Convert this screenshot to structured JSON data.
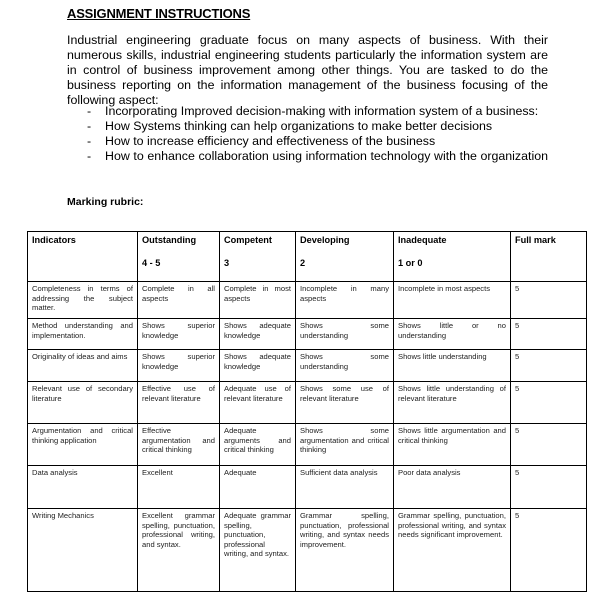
{
  "document": {
    "title": "ASSIGNMENT INSTRUCTIONS",
    "paragraph": "Industrial engineering graduate focus on many aspects of business. With their numerous skills, industrial engineering students particularly the information system are in control of business improvement among other things. You are tasked to do the business reporting on the information management of the business focusing of the following aspect:",
    "bullets": [
      "Incorporating Improved decision-making with information system of a business:",
      "How Systems thinking can help organizations to make better decisions",
      "How to increase efficiency and effectiveness of the business",
      "How to enhance collaboration using information technology with the organization"
    ],
    "bullet_marker": "-",
    "rubric_heading": "Marking rubric:"
  },
  "rubric": {
    "headers": [
      {
        "label": "Indicators",
        "range": ""
      },
      {
        "label": "Outstanding",
        "range": "4 - 5"
      },
      {
        "label": "Competent",
        "range": "3"
      },
      {
        "label": "Developing",
        "range": "2"
      },
      {
        "label": "Inadequate",
        "range": "1 or 0"
      },
      {
        "label": "Full mark",
        "range": ""
      }
    ],
    "rows": [
      {
        "indicator": "Completeness in terms of addressing the subject matter.",
        "outstanding": "Complete in all aspects",
        "competent": "Complete in most aspects",
        "developing": "Incomplete in many aspects",
        "inadequate": "Incomplete in most aspects",
        "full_mark": "5"
      },
      {
        "indicator": "Method understanding and implementation.",
        "outstanding": "Shows superior knowledge",
        "competent": "Shows adequate knowledge",
        "developing": "Shows some understanding",
        "inadequate": "Shows little or no understanding",
        "full_mark": "5"
      },
      {
        "indicator": "Originality of ideas and aims",
        "outstanding": "Shows superior knowledge",
        "competent": "Shows adequate knowledge",
        "developing": "Shows some understanding",
        "inadequate": "Shows little understanding",
        "full_mark": "5"
      },
      {
        "indicator": "Relevant use of secondary literature",
        "outstanding": "Effective use of relevant literature",
        "competent": "Adequate use of relevant literature",
        "developing": "Shows some use of relevant literature",
        "inadequate": "Shows little understanding of relevant literature",
        "full_mark": "5"
      },
      {
        "indicator": "Argumentation and critical thinking application",
        "outstanding": "Effective argumentation and critical thinking",
        "competent": "Adequate arguments and critical thinking",
        "developing": "Shows some argumentation and critical thinking",
        "inadequate": "Shows little argumentation and critical thinking",
        "full_mark": "5"
      },
      {
        "indicator": "Data analysis",
        "outstanding": "Excellent",
        "competent": "Adequate",
        "developing": "Sufficient data analysis",
        "inadequate": "Poor data analysis",
        "full_mark": "5"
      },
      {
        "indicator": "Writing Mechanics",
        "outstanding": "Excellent grammar spelling, punctuation, professional writing, and syntax.",
        "competent": "Adequate grammar spelling, punctuation, professional writing, and syntax.",
        "developing": "Grammar spelling, punctuation, professional writing, and syntax needs improvement.",
        "inadequate": "Grammar spelling, punctuation, professional writing, and syntax needs significant improvement.",
        "full_mark": "5"
      }
    ]
  }
}
